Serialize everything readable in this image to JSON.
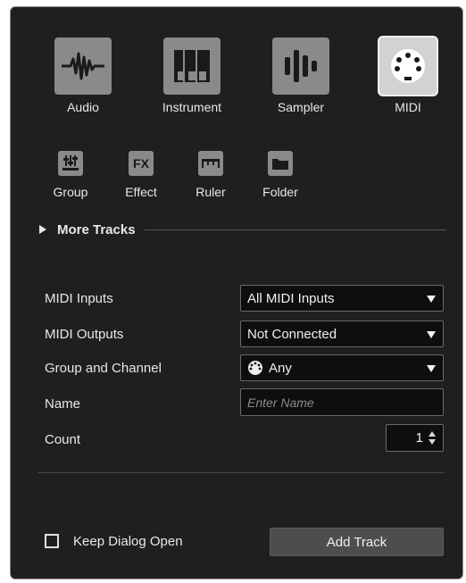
{
  "track_types": [
    {
      "label": "Audio",
      "icon": "audio-waveform-icon",
      "selected": false
    },
    {
      "label": "Instrument",
      "icon": "piano-keys-icon",
      "selected": false
    },
    {
      "label": "Sampler",
      "icon": "sampler-bars-icon",
      "selected": false
    },
    {
      "label": "MIDI",
      "icon": "midi-connector-icon",
      "selected": true
    }
  ],
  "small_types": [
    {
      "label": "Group",
      "icon": "group-fader-icon"
    },
    {
      "label": "Effect",
      "icon": "fx-icon",
      "text": "FX"
    },
    {
      "label": "Ruler",
      "icon": "ruler-icon"
    },
    {
      "label": "Folder",
      "icon": "folder-icon"
    }
  ],
  "more_tracks": {
    "label": "More Tracks"
  },
  "form": {
    "midi_inputs": {
      "label": "MIDI Inputs",
      "value": "All MIDI Inputs"
    },
    "midi_outputs": {
      "label": "MIDI Outputs",
      "value": "Not Connected"
    },
    "group_channel": {
      "label": "Group and Channel",
      "value": "Any"
    },
    "name": {
      "label": "Name",
      "placeholder": "Enter Name"
    },
    "count": {
      "label": "Count",
      "value": "1"
    }
  },
  "footer": {
    "keep_open_label": "Keep Dialog Open",
    "keep_open_checked": false,
    "add_track_label": "Add Track"
  },
  "colors": {
    "background": "#1f1f1f",
    "tile": "#8a8a8a",
    "tile_selected": "#d2d2d2",
    "field_bg": "#0e0e0e",
    "button_bg": "#4d4d4d",
    "text": "#e8e8e8"
  }
}
